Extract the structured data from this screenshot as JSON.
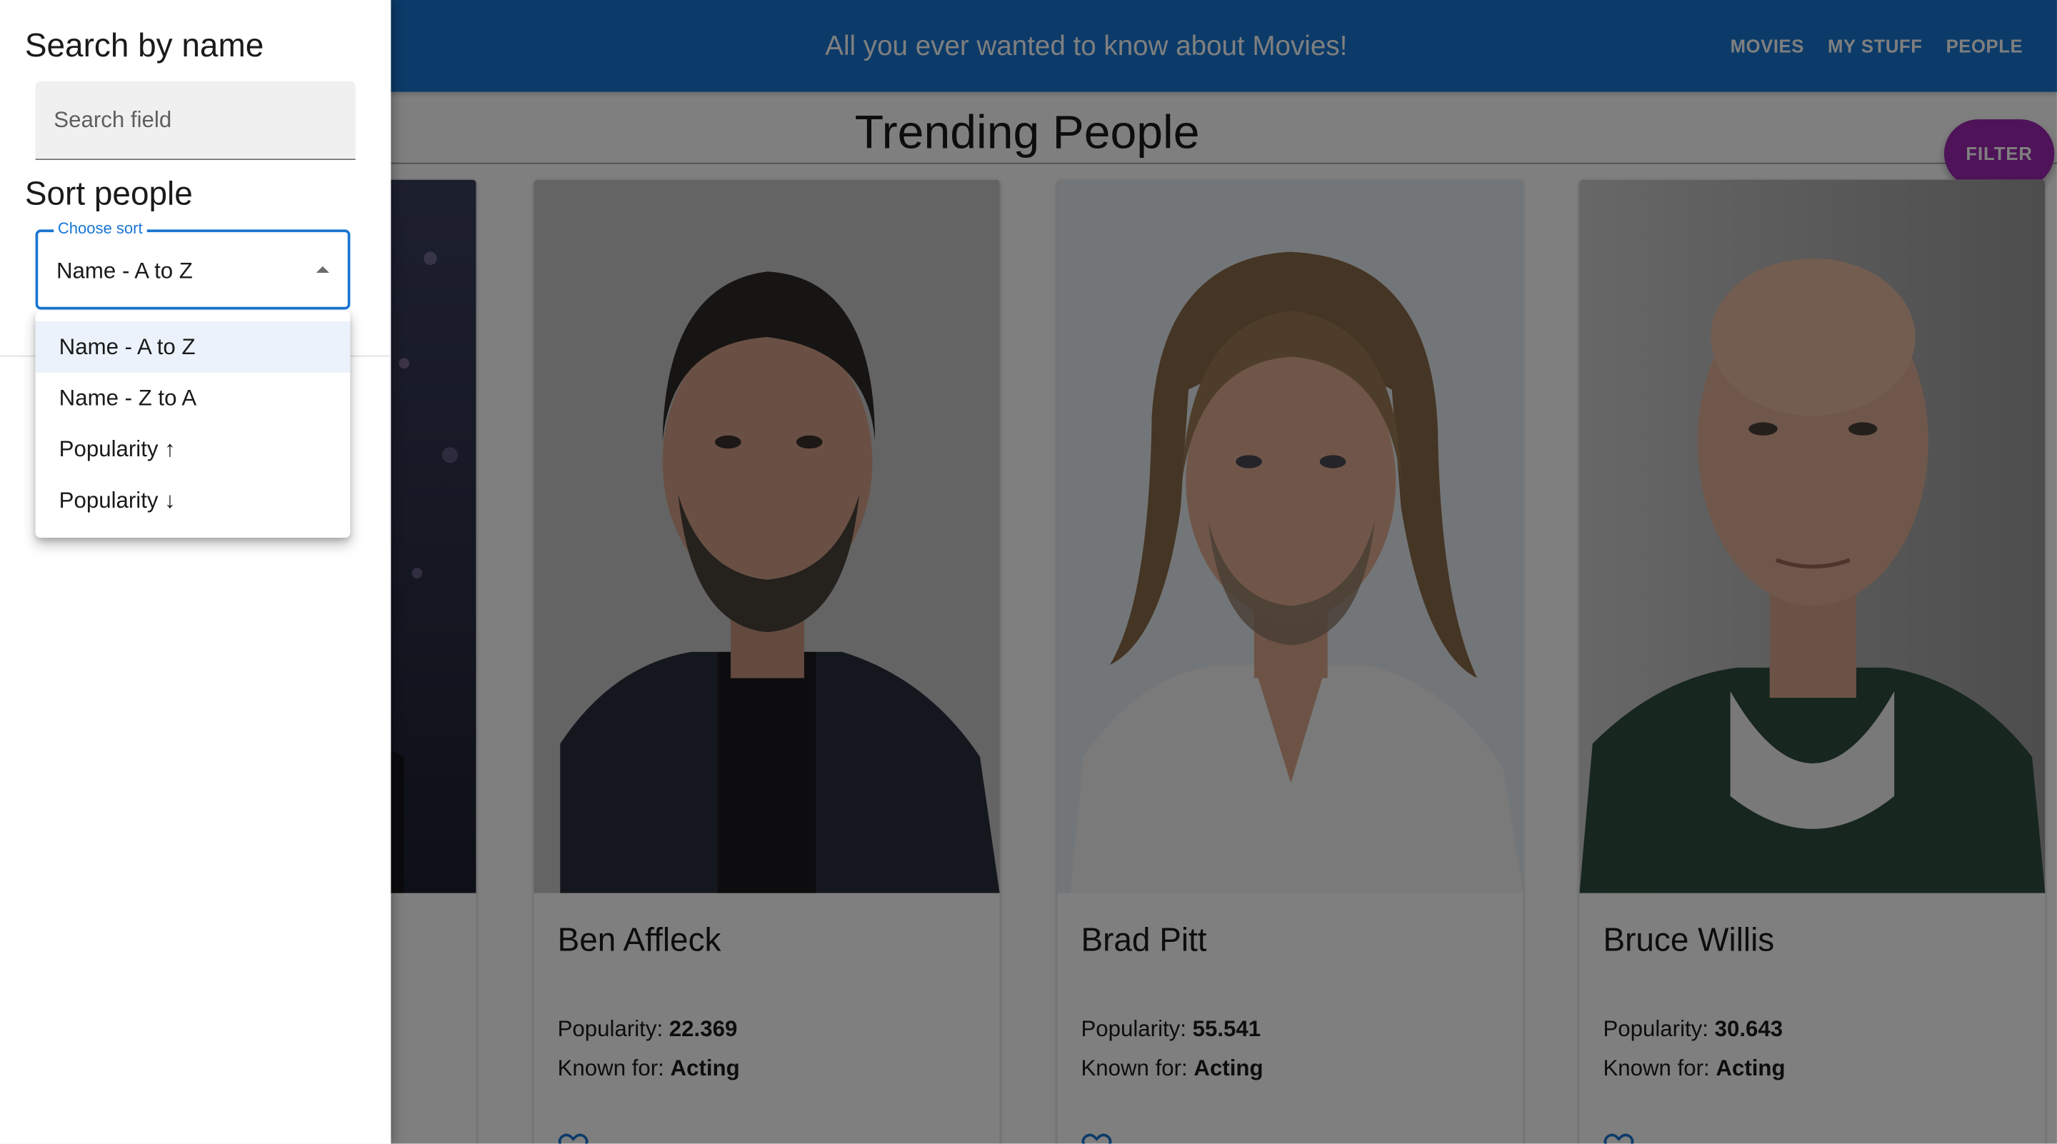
{
  "appbar": {
    "title": "All you ever wanted to know about Movies!",
    "nav": [
      "MOVIES",
      "MY STUFF",
      "PEOPLE"
    ]
  },
  "page": {
    "title": "Trending People",
    "filter_label": "FILTER"
  },
  "people": [
    {
      "name": "",
      "popularity": "",
      "known_for": ""
    },
    {
      "name": "Ben Affleck",
      "popularity": "22.369",
      "known_for": "Acting"
    },
    {
      "name": "Brad Pitt",
      "popularity": "55.541",
      "known_for": "Acting"
    },
    {
      "name": "Bruce Willis",
      "popularity": "30.643",
      "known_for": "Acting"
    }
  ],
  "labels": {
    "popularity": "Popularity: ",
    "known_for": "Known for: "
  },
  "drawer": {
    "search_heading": "Search by name",
    "search_placeholder": "Search field",
    "sort_heading": "Sort people",
    "sort_legend": "Choose sort",
    "sort_value": "Name - A to Z",
    "sort_options": [
      "Name - A to Z",
      "Name - Z to A",
      "Popularity ↑",
      "Popularity ↓"
    ],
    "selected_index": 0
  },
  "colors": {
    "appbar": "#1976d2",
    "filter": "#9c27b0",
    "accent": "#1976d2",
    "favorite": "#1976d2"
  },
  "icons": [
    "heart-outline-icon",
    "caret-up-icon"
  ]
}
